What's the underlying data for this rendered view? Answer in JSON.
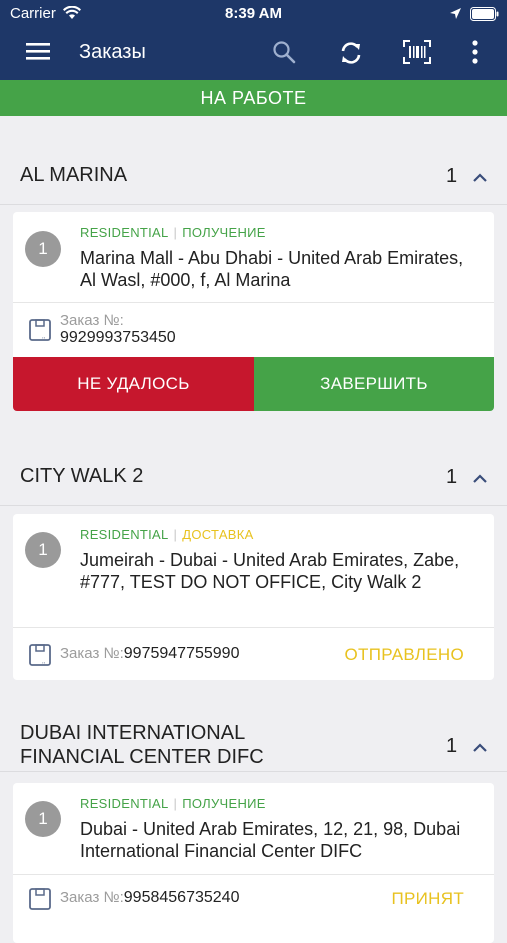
{
  "status_bar": {
    "carrier": "Carrier",
    "time": "8:39 AM"
  },
  "app_bar": {
    "title": "Заказы",
    "icons": [
      "menu-icon",
      "search-icon",
      "refresh-icon",
      "barcode-scan-icon",
      "more-vert-icon"
    ]
  },
  "banner": {
    "label": "НА РАБОТЕ",
    "color": "#45a348"
  },
  "groups": [
    {
      "name": "AL MARINA",
      "count": "1",
      "order": {
        "number": "1",
        "type": "RESIDENTIAL",
        "action": "ПОЛУЧЕНИЕ",
        "address": "Marina Mall - Abu Dhabi - United Arab Emirates, Al Wasl, #000, f, Al Marina",
        "order_label": "Заказ №:",
        "order_number": "9929993753450",
        "buttons": {
          "fail": "НЕ УДАЛОСЬ",
          "complete": "ЗАВЕРШИТЬ"
        }
      }
    },
    {
      "name": "CITY WALK 2",
      "count": "1",
      "order": {
        "number": "1",
        "type": "RESIDENTIAL",
        "action": "ДОСТАВКА",
        "address": "Jumeirah - Dubai - United Arab Emirates, Zabe, #777, TEST DO NOT OFFICE, City Walk 2",
        "order_label": "Заказ №:",
        "order_number": "9975947755990",
        "status": "ОТПРАВЛЕНО"
      }
    },
    {
      "name": "DUBAI INTERNATIONAL FINANCIAL CENTER DIFC",
      "count": "1",
      "order": {
        "number": "1",
        "type": "RESIDENTIAL",
        "action": "ПОЛУЧЕНИЕ",
        "address": "Dubai - United Arab Emirates, 12, 21, 98, Dubai International Financial Center DIFC",
        "order_label": "Заказ №:",
        "order_number": "9958456735240",
        "status": "ПРИНЯТ"
      }
    }
  ],
  "colors": {
    "header": "#1e3768",
    "green": "#45a348",
    "red": "#c6172d",
    "yellow": "#e8c21f",
    "background": "#efeff2"
  }
}
